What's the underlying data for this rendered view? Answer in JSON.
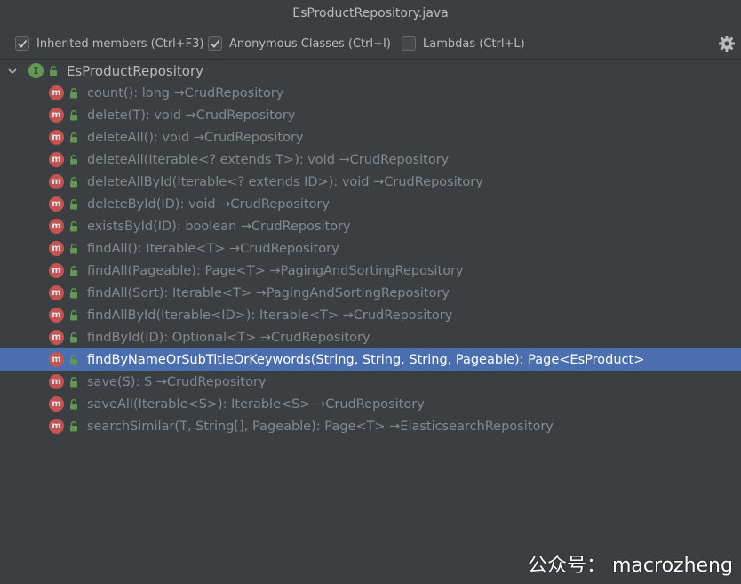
{
  "window": {
    "title": "EsProductRepository.java"
  },
  "toolbar": {
    "checkboxes": [
      {
        "label": "Inherited members (Ctrl+F3)",
        "checked": true
      },
      {
        "label": "Anonymous Classes (Ctrl+I)",
        "checked": true
      },
      {
        "label": "Lambdas (Ctrl+L)",
        "checked": false
      }
    ],
    "settings_icon": "gear-icon"
  },
  "tree": {
    "root": {
      "label": "EsProductRepository",
      "icon": "interface-icon",
      "expanded": true
    },
    "items": [
      {
        "label": "count(): long →CrudRepository"
      },
      {
        "label": "delete(T): void →CrudRepository"
      },
      {
        "label": "deleteAll(): void →CrudRepository"
      },
      {
        "label": "deleteAll(Iterable<? extends T>): void →CrudRepository"
      },
      {
        "label": "deleteAllById(Iterable<? extends ID>): void →CrudRepository"
      },
      {
        "label": "deleteById(ID): void →CrudRepository"
      },
      {
        "label": "existsById(ID): boolean →CrudRepository"
      },
      {
        "label": "findAll(): Iterable<T> →CrudRepository"
      },
      {
        "label": "findAll(Pageable): Page<T> →PagingAndSortingRepository"
      },
      {
        "label": "findAll(Sort): Iterable<T> →PagingAndSortingRepository"
      },
      {
        "label": "findAllById(Iterable<ID>): Iterable<T> →CrudRepository"
      },
      {
        "label": "findById(ID): Optional<T> →CrudRepository"
      },
      {
        "label": "findByNameOrSubTitleOrKeywords(String, String, String, Pageable): Page<EsProduct>",
        "selected": true
      },
      {
        "label": "save(S): S →CrudRepository"
      },
      {
        "label": "saveAll(Iterable<S>): Iterable<S> →CrudRepository"
      },
      {
        "label": "searchSimilar(T, String[], Pageable): Page<T> →ElasticsearchRepository"
      }
    ]
  },
  "watermark": {
    "text": "公众号： macrozheng"
  },
  "colors": {
    "background": "#3c3f41",
    "selection": "#4b6eaf",
    "inherited_text": "#7f8b91",
    "method_icon": "#c25454",
    "interface_icon": "#629755",
    "lock_icon": "#629755"
  }
}
